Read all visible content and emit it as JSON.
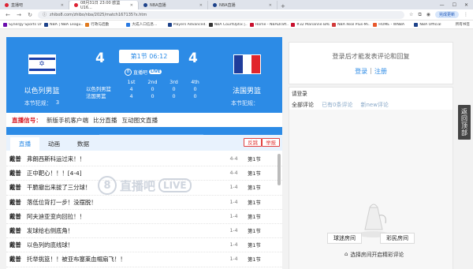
{
  "browser": {
    "tabs": [
      {
        "label": "直播吧",
        "active": false
      },
      {
        "label": "08月31日 23:00 欧篮U16...",
        "active": true
      },
      {
        "label": "NBA直播",
        "active": false
      },
      {
        "label": "NBA直播",
        "active": false
      }
    ],
    "url": "zhibo8.com/zhibo/nba/2025/match167135?x.htm",
    "update_label": "完成更新",
    "bookmarks": [
      {
        "label": "Synergy Sports Un...",
        "color": "#6a0dad"
      },
      {
        "label": "NBA | NBA Leagu...",
        "color": "#1d428a"
      },
      {
        "label": "行政与后勤",
        "color": "#e07a1f"
      },
      {
        "label": "大成人口信息...",
        "color": "#2a7ae2"
      },
      {
        "label": "Players Advanced...",
        "color": "#1d428a"
      },
      {
        "label": "NBA CourtOptix |...",
        "color": "#333333"
      },
      {
        "label": "Home - NBADraft...",
        "color": "#c8102e"
      },
      {
        "label": "#32 Marianne BAD...",
        "color": "#c8102e"
      },
      {
        "label": "NBA Real Plus-Mi...",
        "color": "#d23a3a"
      },
      {
        "label": "HOME - WNBA",
        "color": "#e8582c"
      },
      {
        "label": "NBA Official",
        "color": "#1d428a"
      }
    ],
    "bookmarks_all": "所有书签"
  },
  "match": {
    "home": {
      "name": "以色列男篮",
      "fouls_label": "本节犯规：",
      "fouls": "3",
      "score": "4"
    },
    "away": {
      "name": "法国男篮",
      "fouls_label": "本节犯规：",
      "fouls": "",
      "score": "4"
    },
    "period": "第1节 06:12",
    "brand": "直播吧",
    "live": "LIVE",
    "quarters": [
      "1st",
      "2nd",
      "3rd",
      "4th"
    ],
    "home_quarters": [
      "4",
      "0",
      "0",
      "0"
    ],
    "away_quarters": [
      "4",
      "0",
      "0",
      "0"
    ],
    "timeouts_home": "5",
    "timeouts_label": "暂停",
    "timeouts_away": "5"
  },
  "notice": {
    "label": "直播信号：",
    "items": [
      "新版手机客户端",
      "比分直播",
      "互动图文直播"
    ]
  },
  "log": {
    "tabs": [
      "直播",
      "动画",
      "数据"
    ],
    "report_buttons": [
      "反跳",
      "举报"
    ],
    "rows": [
      {
        "who": "戴普",
        "msg": "弗朗西斯科运过来！！",
        "score": "4-4",
        "period": "第1节"
      },
      {
        "who": "戴普",
        "msg": "正中靶心！！！[4-4]",
        "score": "4-4",
        "period": "第1节"
      },
      {
        "who": "戴普",
        "msg": "干脆撤出来拔了三分球！",
        "score": "1-4",
        "period": "第1节"
      },
      {
        "who": "戴普",
        "msg": "落低位背打一步！没摆脱！",
        "score": "1-4",
        "period": "第1节"
      },
      {
        "who": "戴普",
        "msg": "阿夫迪亚变向回拉！！",
        "score": "1-4",
        "period": "第1节"
      },
      {
        "who": "戴普",
        "msg": "发球给右侧底角！",
        "score": "1-4",
        "period": "第1节"
      },
      {
        "who": "戴普",
        "msg": "以色列的底线球！",
        "score": "1-4",
        "period": "第1节"
      },
      {
        "who": "戴普",
        "msg": "托举挑篮！！被亚布塞莱血帽扇飞！！",
        "score": "1-4",
        "period": "第1节"
      }
    ],
    "watermark": "直播吧",
    "watermark_live": "LIVE"
  },
  "login": {
    "tip": "登录后才能发表评论和回复",
    "login": "登录",
    "sep": "|",
    "register": "注册"
  },
  "comments": {
    "heading": "请登录",
    "tabs": [
      "全部评论",
      "已有0条评论",
      "新new评论"
    ],
    "btn_fast": "球迷房间",
    "btn_color": "彩民房间",
    "pick": "选择房间开启精彩评论"
  },
  "backtop": [
    "返",
    "回",
    "顶",
    "部"
  ],
  "colors": {
    "accent": "#2c8be6",
    "alert": "#d8202a"
  }
}
